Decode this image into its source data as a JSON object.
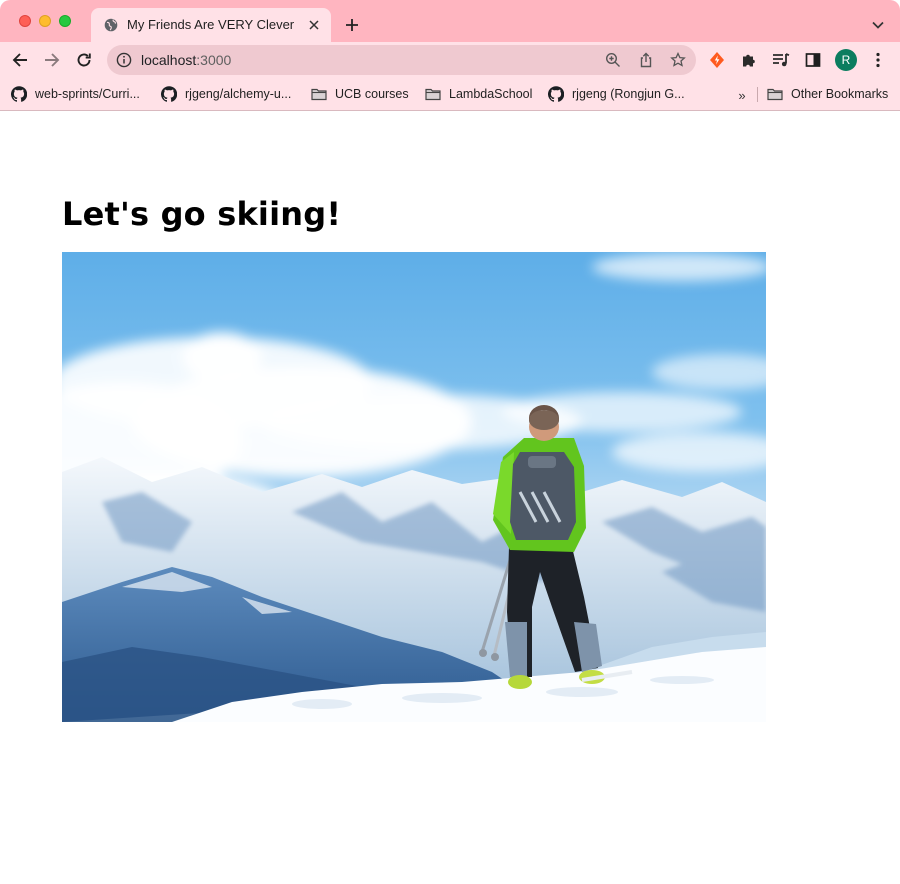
{
  "tab": {
    "title": "My Friends Are VERY Clever"
  },
  "omnibox": {
    "host": "localhost",
    "port": ":3000"
  },
  "profile": {
    "initial": "R"
  },
  "bookmarks": {
    "items": [
      {
        "label": "web-sprints/Curri...",
        "icon": "github-icon"
      },
      {
        "label": "rjgeng/alchemy-u...",
        "icon": "github-icon"
      },
      {
        "label": "UCB courses",
        "icon": "folder-icon"
      },
      {
        "label": "LambdaSchool",
        "icon": "folder-icon"
      },
      {
        "label": "rjgeng (Rongjun G...",
        "icon": "github-icon"
      }
    ],
    "more": "»",
    "other": "Other Bookmarks"
  },
  "page": {
    "heading": "Let's go skiing!",
    "image_subject": "skier on snowy mountain peak"
  }
}
